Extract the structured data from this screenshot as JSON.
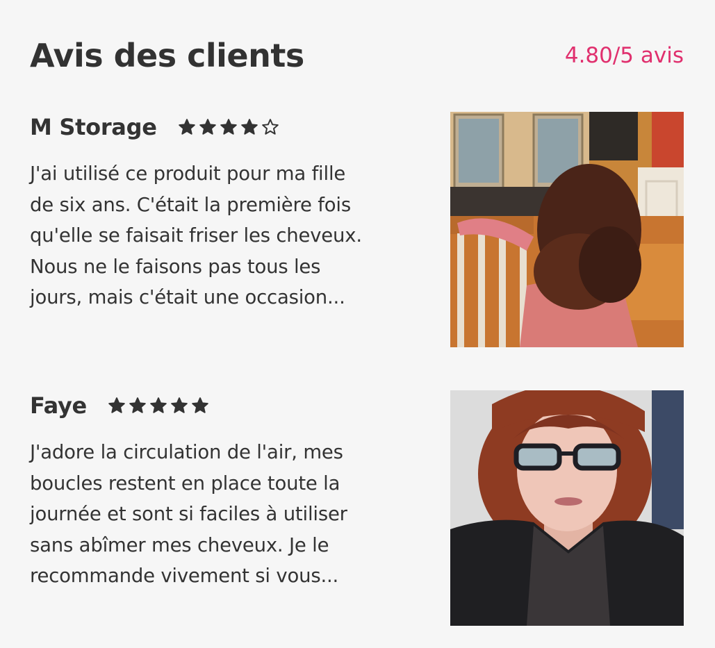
{
  "header": {
    "title": "Avis des clients",
    "rating_summary": "4.80/5 avis"
  },
  "reviews": [
    {
      "name": "M Storage",
      "rating": 4,
      "text_lines": [
        "J'ai utilisé ce produit pour ma fille",
        "de six ans. C'était la première fois",
        "qu'elle se faisait friser les cheveux.",
        "Nous ne le faisons pas tous les",
        "jours, mais c'était une occasion..."
      ]
    },
    {
      "name": "Faye",
      "rating": 5,
      "text_lines": [
        "J'adore la circulation de l'air, mes",
        "boucles restent en place toute la",
        "journée et sont si faciles à utiliser",
        "sans abîmer mes cheveux. Je le",
        "recommande vivement si vous..."
      ]
    }
  ],
  "colors": {
    "accent": "#e0306e",
    "text": "#333333",
    "background": "#f6f6f6"
  },
  "icons": [
    "star-filled-icon",
    "star-empty-icon"
  ]
}
